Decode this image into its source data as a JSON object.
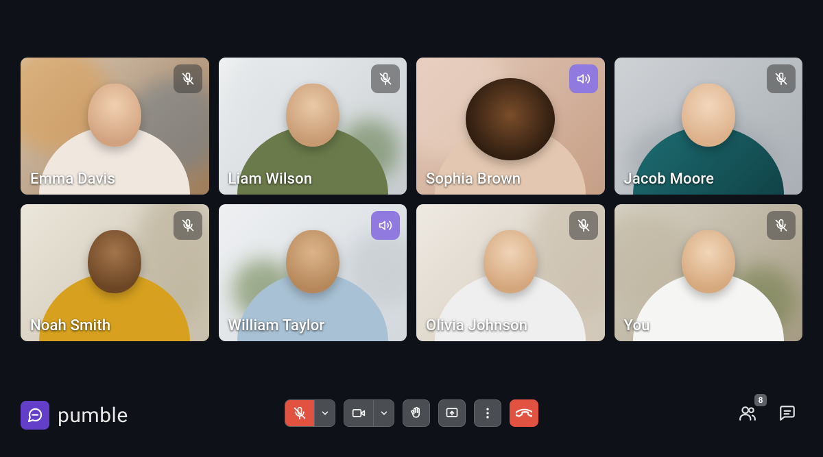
{
  "brand": {
    "name": "pumble"
  },
  "colors": {
    "accent": "#7b61d3",
    "speaking_badge": "#9079df",
    "danger": "#e15241",
    "toolbar_button": "#4a4d52",
    "page_bg": "#0e1218"
  },
  "participants": [
    {
      "name": "Emma Davis",
      "muted": true,
      "speaking": false
    },
    {
      "name": "Liam Wilson",
      "muted": true,
      "speaking": false
    },
    {
      "name": "Sophia Brown",
      "muted": false,
      "speaking": true
    },
    {
      "name": "Jacob Moore",
      "muted": true,
      "speaking": false
    },
    {
      "name": "Noah Smith",
      "muted": true,
      "speaking": false
    },
    {
      "name": "William Taylor",
      "muted": false,
      "speaking": true
    },
    {
      "name": "Olivia Johnson",
      "muted": true,
      "speaking": false
    },
    {
      "name": "You",
      "muted": true,
      "speaking": false
    }
  ],
  "toolbar": {
    "mic_muted": true,
    "camera_on": true,
    "icons": {
      "mic": "mic-off-icon",
      "mic_menu": "chevron-down-icon",
      "camera": "video-icon",
      "cam_menu": "chevron-down-icon",
      "raise_hand": "raise-hand-icon",
      "share": "share-screen-icon",
      "more": "more-vertical-icon",
      "hangup": "hangup-icon"
    }
  },
  "right_controls": {
    "participant_count": "8",
    "icons": {
      "participants": "participants-icon",
      "chat": "chat-icon"
    }
  }
}
